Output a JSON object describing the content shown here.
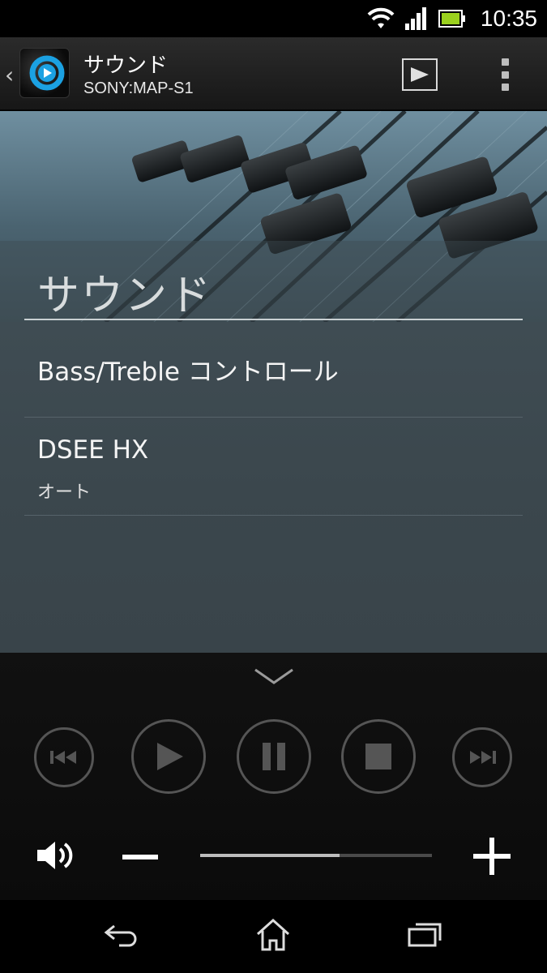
{
  "status_bar": {
    "time": "10:35",
    "icons": [
      "wifi-icon",
      "signal-icon",
      "battery-icon"
    ]
  },
  "action_bar": {
    "title": "サウンド",
    "subtitle": "SONY:MAP-S1",
    "icons": [
      "back-chevron-icon",
      "app-icon",
      "play-icon",
      "overflow-menu-icon"
    ]
  },
  "content": {
    "section_title": "サウンド",
    "items": [
      {
        "title": "Bass/Treble コントロール"
      },
      {
        "title": "DSEE HX",
        "subtitle": "オート"
      }
    ]
  },
  "player": {
    "controls": [
      "previous-icon",
      "play-icon",
      "pause-icon",
      "stop-icon",
      "next-icon"
    ],
    "volume_level": 0.6
  },
  "nav_bar": {
    "icons": [
      "back-icon",
      "home-icon",
      "recent-apps-icon"
    ]
  },
  "colors": {
    "content_bg": "#3f4c53",
    "player_bg": "#111111",
    "accent": "#1ba1e2"
  }
}
